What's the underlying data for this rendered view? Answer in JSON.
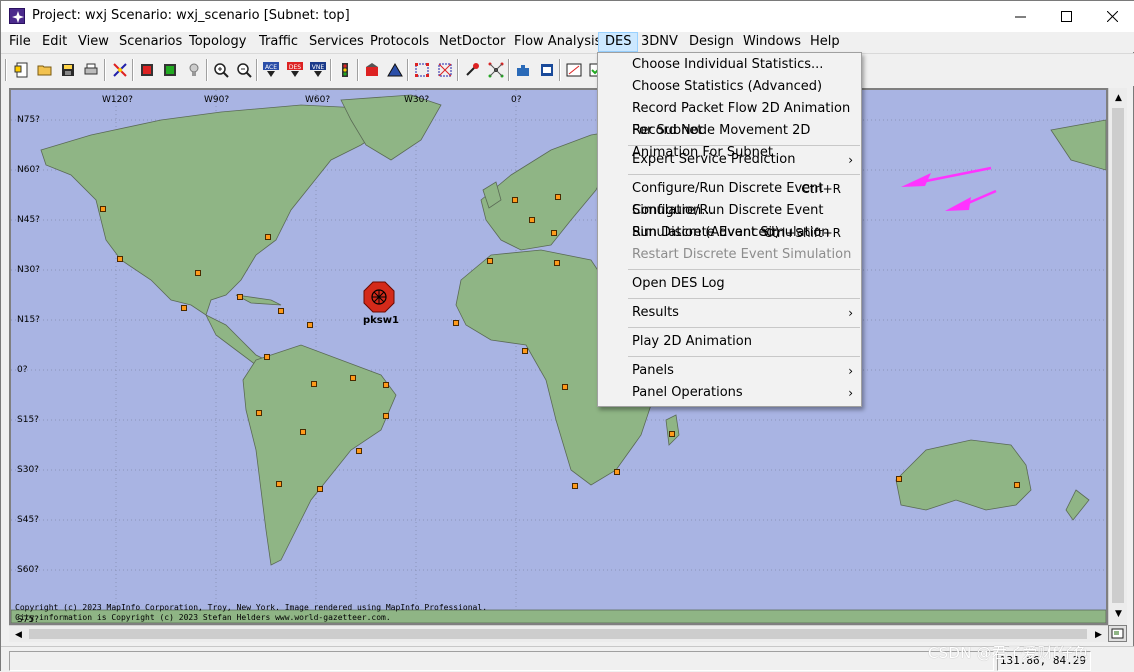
{
  "window": {
    "title": "Project: wxj Scenario: wxj_scenario  [Subnet: top]",
    "controls": {
      "minimize": "—",
      "maximize": "☐",
      "close": "✕"
    }
  },
  "menubar": {
    "items": [
      "File",
      "Edit",
      "View",
      "Scenarios",
      "Topology",
      "Traffic",
      "Services",
      "Protocols",
      "NetDoctor",
      "Flow Analysis",
      "DES",
      "3DNV",
      "Design",
      "Windows",
      "Help"
    ],
    "active": "DES"
  },
  "toolbar": {
    "icons": [
      "new-project-icon",
      "open-icon",
      "save-icon",
      "print-icon",
      "check-links-icon",
      "fail-node-icon",
      "recover-node-icon",
      "bulb-icon",
      "zoom-in-icon",
      "zoom-out-icon",
      "ace-icon",
      "des-icon",
      "vne-icon",
      "traffic-light-icon",
      "config-icon",
      "triangle-icon",
      "grid-select-icon",
      "grid-deselect-icon",
      "failure-icon",
      "topology-icon",
      "puzzle-icon",
      "hw-icon",
      "panel-icon",
      "check-icon"
    ],
    "labels": {
      "ace": "ACE",
      "des": "DES",
      "vne": "VNE"
    }
  },
  "map": {
    "lat_labels": [
      "N75?",
      "N60?",
      "N45?",
      "N30?",
      "N15?",
      "0?",
      "S15?",
      "S30?",
      "S45?",
      "S60?",
      "S75?"
    ],
    "lon_labels": [
      "W120?",
      "W90?",
      "W60?",
      "W30?",
      "0?"
    ],
    "copyright_lines": [
      "Copyright (c) 2023 MapInfo Corporation, Troy, New York. Image rendered using MapInfo Professional.",
      "City information is Copyright (c) 2023 Stefan Helders www.world-gazetteer.com."
    ],
    "device_label": "pksw1",
    "colors": {
      "ocean": "#a9b4e3",
      "land": "#8fb585",
      "coast": "#5a6a55",
      "node": "#ff9a1a",
      "device": "#d42a1a"
    }
  },
  "des_menu": {
    "groups": [
      [
        {
          "label": "Choose Individual Statistics...",
          "shortcut": "",
          "submenu": false,
          "enabled": true
        },
        {
          "label": "Choose Statistics (Advanced)",
          "shortcut": "",
          "submenu": false,
          "enabled": true
        },
        {
          "label": "Record Packet Flow 2D Animation For Subnet",
          "shortcut": "",
          "submenu": false,
          "enabled": true
        },
        {
          "label": "Record Node Movement 2D Animation For Subnet",
          "shortcut": "",
          "submenu": false,
          "enabled": true
        }
      ],
      [
        {
          "label": "Expert Service Prediction",
          "shortcut": "",
          "submenu": true,
          "enabled": true
        }
      ],
      [
        {
          "label": "Configure/Run Discrete Event Simulation...",
          "shortcut": "Ctrl+R",
          "submenu": false,
          "enabled": true
        },
        {
          "label": "Configure/Run Discrete Event Simulation (Advanced)",
          "shortcut": "",
          "submenu": false,
          "enabled": true
        },
        {
          "label": "Run Discrete Event Simulation",
          "shortcut": "Ctrl+Shift+R",
          "submenu": false,
          "enabled": true
        },
        {
          "label": "Restart Discrete Event Simulation",
          "shortcut": "",
          "submenu": false,
          "enabled": false
        }
      ],
      [
        {
          "label": "Open DES Log",
          "shortcut": "",
          "submenu": false,
          "enabled": true
        }
      ],
      [
        {
          "label": "Results",
          "shortcut": "",
          "submenu": true,
          "enabled": true
        }
      ],
      [
        {
          "label": "Play 2D Animation",
          "shortcut": "",
          "submenu": false,
          "enabled": true
        }
      ],
      [
        {
          "label": "Panels",
          "shortcut": "",
          "submenu": true,
          "enabled": true
        },
        {
          "label": "Panel Operations",
          "shortcut": "",
          "submenu": true,
          "enabled": true
        }
      ]
    ],
    "submenu_glyph": "›"
  },
  "status": {
    "coords": "131.86, 84.29"
  },
  "watermark": "CSDN @君子爱财f仔色",
  "annotation_color": "#ff33ff"
}
